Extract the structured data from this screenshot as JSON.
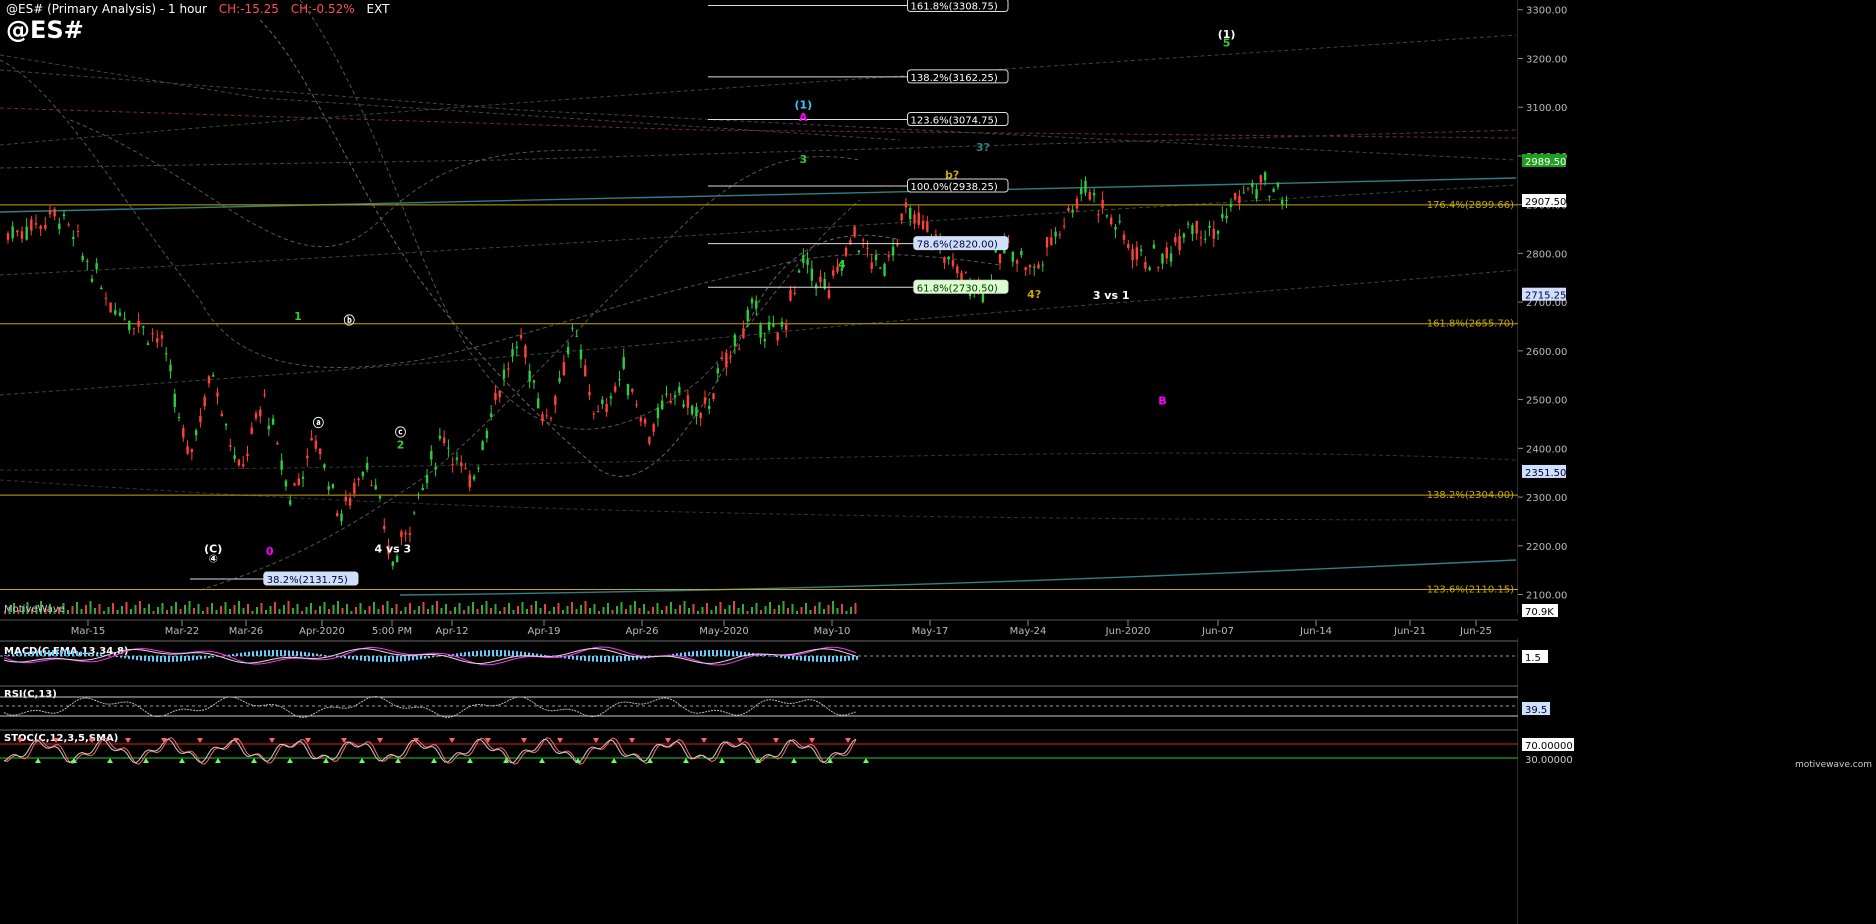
{
  "header": {
    "title": "@ES# (Primary Analysis) - 1 hour",
    "change_points": "CH:-15.25",
    "change_pct": "CH:-0.52%",
    "session": "EXT",
    "symbol": "@ES#"
  },
  "brand": {
    "bottom_left": "MotiveWave",
    "bottom_right": "motivewave.com",
    "watermark": "$TOCK Waves"
  },
  "colors": {
    "background": "#000000",
    "gold": "#c8a800",
    "teal": "#2f7f86",
    "green": "#33cc33",
    "magenta": "#ff00ff",
    "cyan": "#33ccff",
    "pink": "#ff66cc",
    "watermark_green": "#0d5c0d",
    "watermark_brown": "#5a3d12"
  },
  "chart_data": [
    {
      "type": "candlestick",
      "title": "@ES# (Primary Analysis) - 1 hour",
      "x_ticks": [
        "Mar-15",
        "Mar-22",
        "Mar-26",
        "Apr-2020",
        "5:00 PM",
        "Apr-12",
        "Apr-19",
        "Apr-26",
        "May-2020",
        "May-10",
        "May-17",
        "May-24",
        "Jun-2020",
        "Jun-07",
        "Jun-14",
        "Jun-21",
        "Jun-25"
      ],
      "y_ticks": [
        2100,
        2200,
        2300,
        2400,
        2500,
        2600,
        2700,
        2800,
        2900,
        3000,
        3100,
        3200,
        3300
      ],
      "ylim": [
        2060,
        3320
      ],
      "price_path": {
        "x_index": [
          0,
          2,
          4,
          6,
          7,
          8,
          9,
          10,
          11,
          12,
          13,
          14,
          15,
          16,
          17,
          18,
          19,
          20,
          21,
          22,
          23,
          24,
          25,
          26,
          27,
          28,
          29,
          30,
          31,
          32,
          33,
          34,
          35,
          36,
          37,
          38,
          39,
          40,
          41,
          42,
          43,
          44,
          45,
          46,
          47,
          48,
          49,
          50
        ],
        "price": [
          2840,
          2880,
          2700,
          2620,
          2380,
          2560,
          2350,
          2500,
          2300,
          2420,
          2260,
          2380,
          2160,
          2300,
          2430,
          2320,
          2510,
          2620,
          2450,
          2640,
          2460,
          2560,
          2430,
          2520,
          2460,
          2580,
          2680,
          2620,
          2780,
          2720,
          2840,
          2760,
          2880,
          2840,
          2760,
          2730,
          2820,
          2760,
          2860,
          2940,
          2870,
          2800,
          2780,
          2870,
          2840,
          2920,
          2940,
          2900
        ]
      },
      "price_badges": [
        {
          "text": "3300.00",
          "value": 3300,
          "style": "tick"
        },
        {
          "text": "2989.50",
          "value": 2989.5,
          "style": "green"
        },
        {
          "text": "2907.50",
          "value": 2907.5,
          "style": "white"
        },
        {
          "text": "2715.25",
          "value": 2715.25,
          "style": "blue"
        },
        {
          "text": "2351.50",
          "value": 2351.5,
          "style": "blue"
        }
      ],
      "fib_lines": [
        {
          "label": "161.8%(3308.75)",
          "value": 3308.75
        },
        {
          "label": "138.2%(3162.25)",
          "value": 3162.25
        },
        {
          "label": "123.6%(3074.75)",
          "value": 3074.75
        },
        {
          "label": "100.0%(2938.25)",
          "value": 2938.25
        },
        {
          "label": "78.6%(2820.00)",
          "value": 2820.0
        },
        {
          "label": "61.8%(2730.50)",
          "value": 2730.5
        },
        {
          "label": "38.2%(2131.75)",
          "value": 2131.75
        }
      ],
      "gold_levels": [
        {
          "label": "176.4%(2899.66)",
          "value": 2899.66
        },
        {
          "label": "161.8%(2655.70)",
          "value": 2655.7
        },
        {
          "label": "138.2%(2304.00)",
          "value": 2304.0
        },
        {
          "label": "123.6%(2110.15)",
          "value": 2110.15
        }
      ],
      "wave_labels": [
        {
          "text": "(1)",
          "color": "#ffffff",
          "x": 47.5,
          "price": 3242
        },
        {
          "text": "5",
          "color": "#33cc33",
          "x": 47.5,
          "price": 3225
        },
        {
          "text": "(1)",
          "color": "#33ccff",
          "x": 31,
          "price": 3097
        },
        {
          "text": "A",
          "color": "#ff00ff",
          "x": 31,
          "price": 3072
        },
        {
          "text": "3",
          "color": "#33cc33",
          "x": 31,
          "price": 2986
        },
        {
          "text": "3?",
          "color": "#2f7f86",
          "x": 38,
          "price": 3010
        },
        {
          "text": "b?",
          "color": "#c8a800",
          "x": 36.8,
          "price": 2954
        },
        {
          "text": "4",
          "color": "#33cc33",
          "x": 32.5,
          "price": 2770
        },
        {
          "text": "4?",
          "color": "#c8a800",
          "x": 40,
          "price": 2708
        },
        {
          "text": "3 vs 1",
          "color": "#ffffff",
          "x": 43,
          "price": 2706
        },
        {
          "text": "1",
          "color": "#33cc33",
          "x": 11.3,
          "price": 2663
        },
        {
          "text": "ⓑ",
          "color": "#ffffff",
          "x": 13.3,
          "price": 2655
        },
        {
          "text": "ⓐ",
          "color": "#ffffff",
          "x": 12.1,
          "price": 2445
        },
        {
          "text": "ⓒ",
          "color": "#ffffff",
          "x": 15.3,
          "price": 2425
        },
        {
          "text": "2",
          "color": "#33cc33",
          "x": 15.3,
          "price": 2400
        },
        {
          "text": "B",
          "color": "#ff00ff",
          "x": 45,
          "price": 2490
        },
        {
          "text": "(C)",
          "color": "#ffffff",
          "x": 8,
          "price": 2186
        },
        {
          "text": "0",
          "color": "#ff00ff",
          "x": 10.2,
          "price": 2181
        },
        {
          "text": "4 vs 3",
          "color": "#ffffff",
          "x": 15,
          "price": 2186
        },
        {
          "text": "④",
          "color": "#ffffff",
          "x": 8,
          "price": 2166
        }
      ]
    },
    {
      "type": "line",
      "title": "MACD(C,EMA,13,34,8)",
      "last_value": "1.5"
    },
    {
      "type": "line",
      "title": "RSI(C,13)",
      "last_value": "39.5"
    },
    {
      "type": "line",
      "title": "STOC(C,12,3,5,SMA)",
      "levels": [
        "70.00000",
        "30.00000"
      ]
    },
    {
      "type": "bar",
      "title": "Volume",
      "last_value": "70.9K"
    }
  ]
}
